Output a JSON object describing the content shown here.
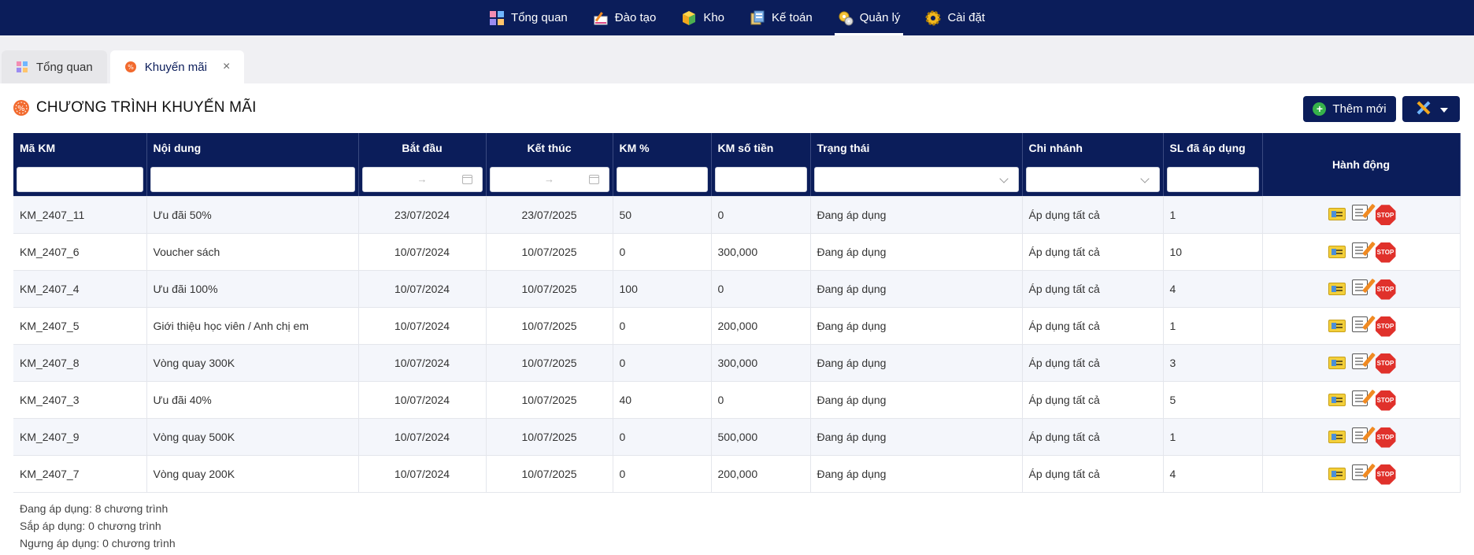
{
  "nav": {
    "items": [
      {
        "label": "Tổng quan",
        "icon": "dashboard-icon"
      },
      {
        "label": "Đào tạo",
        "icon": "training-icon"
      },
      {
        "label": "Kho",
        "icon": "warehouse-icon"
      },
      {
        "label": "Kế toán",
        "icon": "accounting-icon"
      },
      {
        "label": "Quản lý",
        "icon": "management-icon",
        "active": true
      },
      {
        "label": "Cài đặt",
        "icon": "settings-icon"
      }
    ]
  },
  "tabs": [
    {
      "label": "Tổng quan",
      "icon": "dashboard-icon"
    },
    {
      "label": "Khuyến mãi",
      "icon": "promotion-icon",
      "active": true,
      "close": "×"
    }
  ],
  "page": {
    "title": "CHƯƠNG TRÌNH KHUYẾN MÃI",
    "add_label": "Thêm mới"
  },
  "table": {
    "headers": {
      "code": "Mã KM",
      "content": "Nội dung",
      "start": "Bắt đầu",
      "end": "Kết thúc",
      "percent": "KM %",
      "amount": "KM số tiền",
      "status": "Trạng thái",
      "branch": "Chi nhánh",
      "used": "SL đã áp dụng",
      "actions": "Hành động"
    },
    "filters": {
      "date_sep": "→"
    },
    "rows": [
      {
        "code": "KM_2407_11",
        "content": "Ưu đãi 50%",
        "start": "23/07/2024",
        "end": "23/07/2025",
        "percent": "50",
        "amount": "0",
        "status": "Đang áp dụng",
        "branch": "Áp dụng tất cả",
        "used": "1"
      },
      {
        "code": "KM_2407_6",
        "content": "Voucher sách",
        "start": "10/07/2024",
        "end": "10/07/2025",
        "percent": "0",
        "amount": "300,000",
        "status": "Đang áp dụng",
        "branch": "Áp dụng tất cả",
        "used": "10"
      },
      {
        "code": "KM_2407_4",
        "content": "Ưu đãi 100%",
        "start": "10/07/2024",
        "end": "10/07/2025",
        "percent": "100",
        "amount": "0",
        "status": "Đang áp dụng",
        "branch": "Áp dụng tất cả",
        "used": "4"
      },
      {
        "code": "KM_2407_5",
        "content": "Giới thiệu học viên / Anh chị em",
        "start": "10/07/2024",
        "end": "10/07/2025",
        "percent": "0",
        "amount": "200,000",
        "status": "Đang áp dụng",
        "branch": "Áp dụng tất cả",
        "used": "1"
      },
      {
        "code": "KM_2407_8",
        "content": "Vòng quay 300K",
        "start": "10/07/2024",
        "end": "10/07/2025",
        "percent": "0",
        "amount": "300,000",
        "status": "Đang áp dụng",
        "branch": "Áp dụng tất cả",
        "used": "3"
      },
      {
        "code": "KM_2407_3",
        "content": "Ưu đãi 40%",
        "start": "10/07/2024",
        "end": "10/07/2025",
        "percent": "40",
        "amount": "0",
        "status": "Đang áp dụng",
        "branch": "Áp dụng tất cả",
        "used": "5"
      },
      {
        "code": "KM_2407_9",
        "content": "Vòng quay 500K",
        "start": "10/07/2024",
        "end": "10/07/2025",
        "percent": "0",
        "amount": "500,000",
        "status": "Đang áp dụng",
        "branch": "Áp dụng tất cả",
        "used": "1"
      },
      {
        "code": "KM_2407_7",
        "content": "Vòng quay 200K",
        "start": "10/07/2024",
        "end": "10/07/2025",
        "percent": "0",
        "amount": "200,000",
        "status": "Đang áp dụng",
        "branch": "Áp dụng tất cả",
        "used": "4"
      }
    ],
    "stop_label": "STOP"
  },
  "summary": {
    "active": "Đang áp dụng: 8 chương trình",
    "upcoming": "Sắp áp dụng: 0 chương trình",
    "stopped": "Ngưng áp dụng: 0 chương trình"
  },
  "colors": {
    "nav_bg": "#0b1d5a",
    "add_icon": "#36b24a",
    "stop": "#e0312b"
  }
}
